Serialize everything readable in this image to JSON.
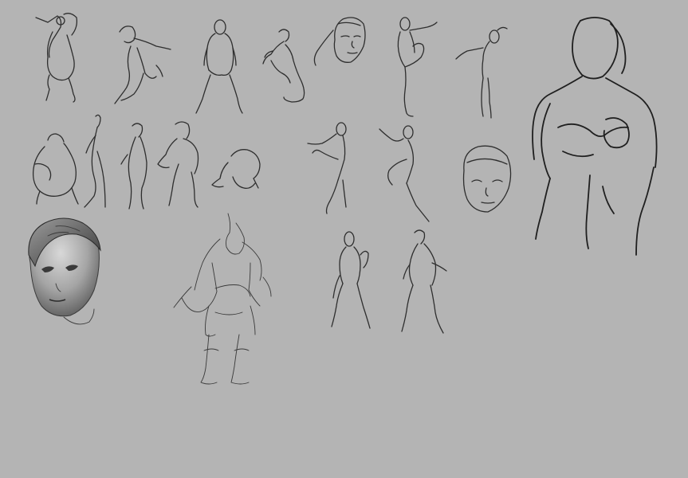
{
  "canvas": {
    "background_color": "#b4b4b4",
    "line_color": "#2e2e2e"
  },
  "sketches": [
    {
      "name": "jumping-pose-sketch"
    },
    {
      "name": "running-pose-sketch"
    },
    {
      "name": "standing-wide-stance-sketch"
    },
    {
      "name": "crouching-pose-sketch"
    },
    {
      "name": "head-with-braid-sketch"
    },
    {
      "name": "high-knee-pose-sketch"
    },
    {
      "name": "side-kick-pose-sketch"
    },
    {
      "name": "muscular-torso-sketch"
    },
    {
      "name": "heavy-bodied-figure-sketch"
    },
    {
      "name": "thin-figure-sketch"
    },
    {
      "name": "side-standing-figure-sketch"
    },
    {
      "name": "brawler-figure-sketch"
    },
    {
      "name": "squatting-figure-sketch"
    },
    {
      "name": "fighting-stance-sketch"
    },
    {
      "name": "knee-raise-sketch"
    },
    {
      "name": "face-front-sketch"
    },
    {
      "name": "rendered-head"
    },
    {
      "name": "armored-warrior-sketch"
    },
    {
      "name": "standing-nude-front-sketch"
    },
    {
      "name": "standing-nude-side-sketch"
    }
  ]
}
